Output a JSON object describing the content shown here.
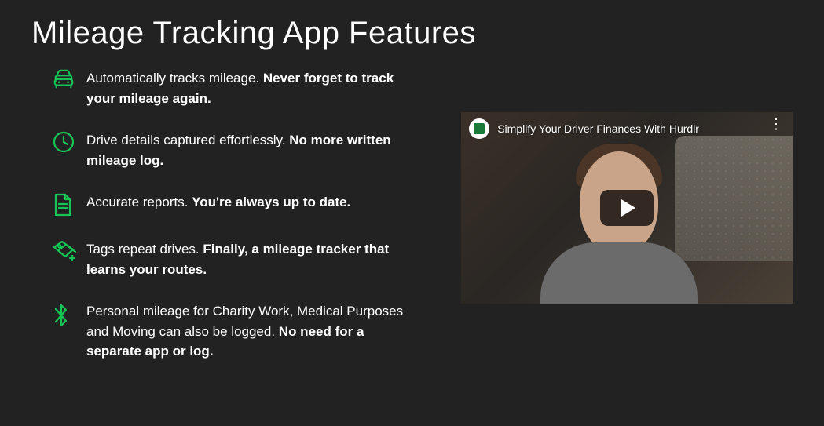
{
  "title": "Mileage Tracking App Features",
  "features": [
    {
      "icon": "car-icon",
      "text_normal": "Automatically tracks mileage. ",
      "text_bold": "Never forget to track your mileage again."
    },
    {
      "icon": "clock-icon",
      "text_normal": "Drive details captured effortlessly. ",
      "text_bold": "No more written mileage log."
    },
    {
      "icon": "document-icon",
      "text_normal": "Accurate reports. ",
      "text_bold": "You're always up to date."
    },
    {
      "icon": "tag-icon",
      "text_normal": "Tags repeat drives. ",
      "text_bold": "Finally, a mileage tracker that learns your routes."
    },
    {
      "icon": "bluetooth-icon",
      "text_normal": "Personal mileage for Charity Work, Medical Purposes and Moving can also be logged. ",
      "text_bold": "No need for a separate app or log."
    }
  ],
  "video": {
    "title": "Simplify Your Driver Finances With Hurdlr",
    "more_glyph": "⋮"
  }
}
